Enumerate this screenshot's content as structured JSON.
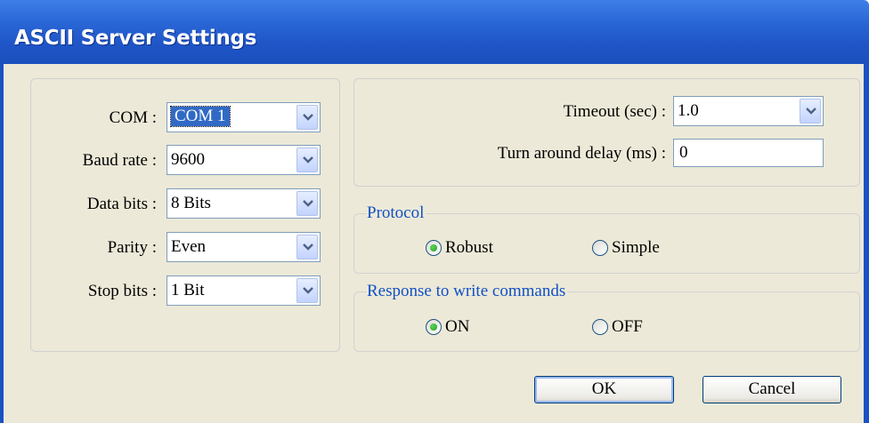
{
  "window": {
    "title": "ASCII Server Settings"
  },
  "serial": {
    "com": {
      "label": "COM :",
      "value": "COM 1"
    },
    "baud_rate": {
      "label": "Baud rate :",
      "value": "9600"
    },
    "data_bits": {
      "label": "Data bits :",
      "value": "8 Bits"
    },
    "parity": {
      "label": "Parity :",
      "value": "Even"
    },
    "stop_bits": {
      "label": "Stop bits :",
      "value": "1 Bit"
    }
  },
  "timing": {
    "timeout": {
      "label": "Timeout (sec) :",
      "value": "1.0"
    },
    "turnaround": {
      "label": "Turn around delay (ms) :",
      "value": "0"
    }
  },
  "protocol": {
    "legend": "Protocol",
    "options": [
      {
        "label": "Robust",
        "selected": true
      },
      {
        "label": "Simple",
        "selected": false
      }
    ]
  },
  "response": {
    "legend": "Response to write commands",
    "options": [
      {
        "label": "ON",
        "selected": true
      },
      {
        "label": "OFF",
        "selected": false
      }
    ]
  },
  "buttons": {
    "ok": "OK",
    "cancel": "Cancel"
  },
  "colors": {
    "title_bar": "#1f55c6",
    "dialog_bg": "#ece9d8",
    "group_legend": "#1250c4",
    "selection": "#316ac5"
  }
}
